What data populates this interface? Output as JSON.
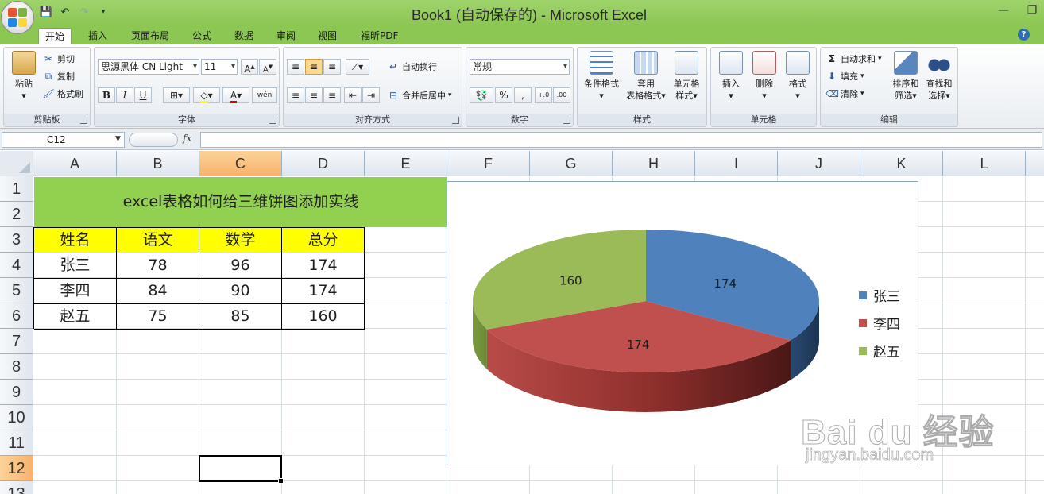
{
  "window": {
    "title": "Book1 (自动保存的) - Microsoft Excel"
  },
  "ribbon": {
    "tabs": [
      {
        "label": "开始",
        "active": true
      },
      {
        "label": "插入"
      },
      {
        "label": "页面布局"
      },
      {
        "label": "公式"
      },
      {
        "label": "数据"
      },
      {
        "label": "审阅"
      },
      {
        "label": "视图"
      },
      {
        "label": "福昕PDF"
      }
    ],
    "clipboard": {
      "label": "剪贴板",
      "paste": "粘贴",
      "cut": "剪切",
      "copy": "复制",
      "format_painter": "格式刷"
    },
    "font": {
      "label": "字体",
      "font_name": "思源黑体 CN Light",
      "font_size": "11",
      "bold": "B",
      "italic": "I",
      "underline": "U",
      "phonetic": "wén"
    },
    "alignment": {
      "label": "对齐方式",
      "wrap_text": "自动换行",
      "merge_center": "合并后居中"
    },
    "number": {
      "label": "数字",
      "format": "常规",
      "percent": "%",
      "comma": ",",
      "inc_decimal": "+.0",
      "dec_decimal": ".00"
    },
    "styles": {
      "label": "样式",
      "conditional": "条件格式",
      "table_format_1": "套用",
      "table_format_2": "表格格式",
      "cell_style_1": "单元格",
      "cell_style_2": "样式"
    },
    "cells": {
      "label": "单元格",
      "insert": "插入",
      "delete": "删除",
      "format": "格式"
    },
    "editing": {
      "label": "编辑",
      "autosum": "自动求和",
      "fill": "填充",
      "clear": "清除",
      "sort_1": "排序和",
      "sort_2": "筛选",
      "find_1": "查找和",
      "find_2": "选择"
    }
  },
  "formula_bar": {
    "name_box": "C12",
    "fx": "fx",
    "content": ""
  },
  "sheet": {
    "columns": [
      "A",
      "B",
      "C",
      "D",
      "E",
      "F",
      "G",
      "H",
      "I",
      "J",
      "K",
      "L"
    ],
    "rows": [
      "1",
      "2",
      "3",
      "4",
      "5",
      "6",
      "7",
      "8",
      "9",
      "10",
      "11",
      "12",
      "13"
    ],
    "selected_col": "C",
    "selected_row": "12",
    "title": "excel表格如何给三维饼图添加实线",
    "table": {
      "headers": [
        "姓名",
        "语文",
        "数学",
        "总分"
      ],
      "rows": [
        [
          "张三",
          "78",
          "96",
          "174"
        ],
        [
          "李四",
          "84",
          "90",
          "174"
        ],
        [
          "赵五",
          "75",
          "85",
          "160"
        ]
      ]
    }
  },
  "chart_data": {
    "type": "pie",
    "categories": [
      "张三",
      "李四",
      "赵五"
    ],
    "values": [
      174,
      174,
      160
    ],
    "data_labels": [
      "174",
      "174",
      "160"
    ],
    "colors": [
      "#4f81bd",
      "#c0504d",
      "#9bbb59"
    ],
    "legend": "right",
    "three_d": true
  },
  "colors": {
    "title_bar": "#8cc653",
    "title_cell": "#92d050",
    "header_fill": "#ffff00",
    "selection_header": "#f8b26c"
  },
  "watermark": {
    "text": "Bai du 经验",
    "url": "jingyan.baidu.com"
  }
}
